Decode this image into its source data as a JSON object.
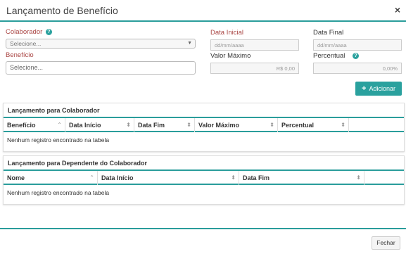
{
  "modal": {
    "title": "Lançamento de Benefício",
    "close_glyph": "×"
  },
  "form": {
    "colaborador": {
      "label": "Colaborador",
      "help_glyph": "?",
      "value": "Selecione...",
      "arrow_glyph": "▼"
    },
    "beneficio": {
      "label": "Benefício",
      "value": "Selecione..."
    },
    "data_inicial": {
      "label": "Data Inicial",
      "placeholder": "dd/mm/aaaa"
    },
    "data_final": {
      "label": "Data Final",
      "placeholder": "dd/mm/aaaa"
    },
    "valor_maximo": {
      "label": "Valor Máximo",
      "value": "R$ 0,00"
    },
    "percentual": {
      "label": "Percentual",
      "help_glyph": "?",
      "value": "0,00%"
    },
    "add_button": {
      "icon_glyph": "+",
      "label": "Adicionar"
    }
  },
  "table_colaborador": {
    "title": "Lançamento para Colaborador",
    "columns": [
      "Benefício",
      "Data Início",
      "Data Fim",
      "Valor Máximo",
      "Percentual"
    ],
    "empty_text": "Nenhum registro encontrado na tabela"
  },
  "table_dependente": {
    "title": "Lançamento para Dependente do Colaborador",
    "columns": [
      "Nome",
      "Data Início",
      "Data Fim"
    ],
    "empty_text": "Nenhum registro encontrado na tabela"
  },
  "footer": {
    "close_label": "Fechar"
  },
  "sort_glyphs": {
    "asc": "⌃",
    "both": "⬍"
  },
  "colors": {
    "accent": "#2a9d9b",
    "required_label": "#a94442"
  }
}
